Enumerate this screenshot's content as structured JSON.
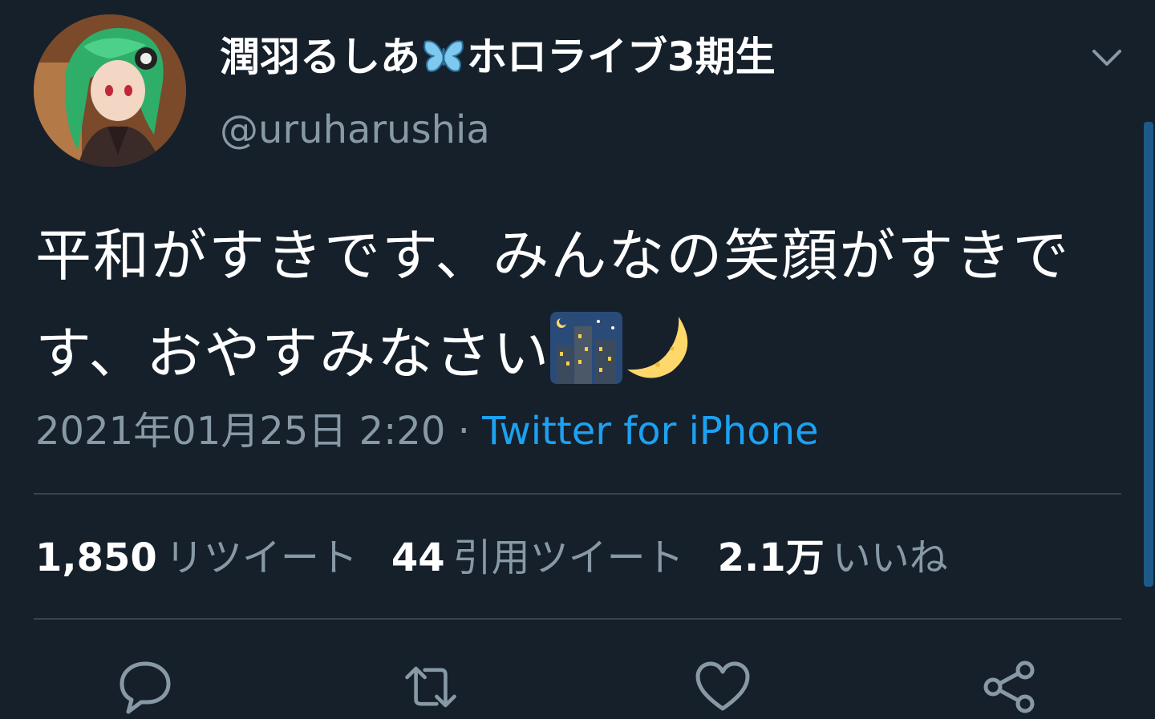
{
  "author": {
    "display_name_part1": "潤羽るしあ",
    "display_name_part2": "ホロライブ3期生",
    "handle": "@uruharushia"
  },
  "tweet": {
    "text": "平和がすきです、みんなの笑顔がすきです、おやすみなさい"
  },
  "meta": {
    "timestamp": "2021年01月25日 2:20",
    "separator": "·",
    "source": "Twitter for iPhone"
  },
  "stats": {
    "retweets_count": "1,850",
    "retweets_label": "リツイート",
    "quotes_count": "44",
    "quotes_label": "引用ツイート",
    "likes_count": "2.1万",
    "likes_label": "いいね"
  },
  "colors": {
    "background": "#15202b",
    "secondary_text": "#8899a6",
    "link": "#1da1f2",
    "divider": "#38444d"
  },
  "icons": {
    "name_emoji": "butterfly-icon",
    "tweet_emojis": [
      "night-city-icon",
      "crescent-moon-icon"
    ],
    "menu": "chevron-down-icon",
    "actions": [
      "reply-icon",
      "retweet-icon",
      "like-icon",
      "share-icon"
    ]
  }
}
